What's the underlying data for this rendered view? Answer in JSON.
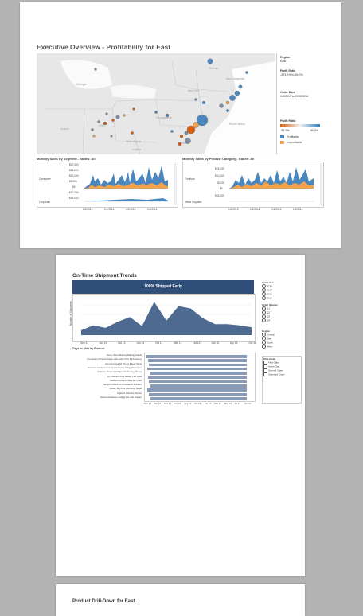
{
  "page1": {
    "title": "Executive Overview - Profitability for East",
    "region_label": "Region",
    "region_value": "East",
    "profit_ratio_label": "Profit Ratio",
    "profit_ratio_value": "-273.0% to 50.0%",
    "order_date_label": "Order Date",
    "order_date_value": "1/4/2013 to 2/15/2016",
    "profit_ratio_legend_label": "Profit Ratio",
    "ramp_min": "-93.0%",
    "ramp_max": "50.0%",
    "profitable_label": "Profitable",
    "unprofitable_label": "Unprofitable",
    "map_place_labels": [
      "Vermont",
      "New Hampshire",
      "Michigan",
      "New York",
      "Pennsylvania",
      "Rhode Island",
      "Indiana",
      "Ohio",
      "West Virginia",
      "Virginia",
      "Maryland"
    ],
    "segment_chart": {
      "title": "Monthly Sales by Segment - States: All",
      "rows": [
        "Consumer",
        "Corporate"
      ],
      "ticks": [
        "$20,000",
        "$15,000",
        "$10,000",
        "$5,000",
        "$0"
      ],
      "ticks2": [
        "$20,000",
        "$15,000"
      ],
      "xticks": [
        "1/1/2013",
        "1/1/2014",
        "1/1/2015",
        "1/1/2016"
      ]
    },
    "category_chart": {
      "title": "Monthly Sales by Product Category - States: All",
      "rows": [
        "Furniture",
        "Office Supplies"
      ],
      "ticks": [
        "$15,000",
        "$10,000",
        "$5,000",
        "$0"
      ],
      "ticks2": [
        "$15,000"
      ],
      "xticks": [
        "1/1/2013",
        "1/1/2014",
        "1/1/2015",
        "1/1/2016"
      ]
    }
  },
  "page2": {
    "title": "On-Time Shipment Trends",
    "banner": "100% Shipped Early",
    "y_axis_label": "Number of Shipments",
    "x_ticks": [
      "Sep 12",
      "Jan 13",
      "Oct 13",
      "Jan 14",
      "Oct 14",
      "Mar 15",
      "Oct 15",
      "Jan 16",
      "Apr 16",
      "Oct 16"
    ],
    "days_title": "Days to Ship by Product",
    "products": [
      "Avery Self-Adhesive Mailing Labels",
      "Companion Product Paper with Letter-Trim Perforations",
      "Acme Coated 18 Printer Paper Stock",
      "Fellowes Advanced Computer Series Surge Protectors",
      "Fellowes Stack and Tape File Storage Boxes",
      "3M Cleaning Pad Mouse Pad Pack",
      "Hewlett Packard LaserJet Toner",
      "Sanford Ultra-Fine Permanent Markers",
      "Master Big Foot Doorstop, Beige",
      "Logitech Wireless Mouse",
      "Deluxe Rollaway Locking File with Drawer"
    ],
    "day_ticks": [
      "Nov 12",
      "Jan 13",
      "Mar 13",
      "Jun 13",
      "Aug 13",
      "Oct 13",
      "Jan 14",
      "Mar 14",
      "May 14",
      "Jul 14",
      "Oct 14"
    ],
    "filters": {
      "order_year_label": "Order Year",
      "order_years": [
        "2013",
        "2014",
        "2015",
        "2016"
      ],
      "order_quarter_label": "Order Quarter",
      "quarters": [
        "Q1",
        "Q2",
        "Q3",
        "Q4"
      ],
      "region_label": "Region",
      "regions": [
        "Central",
        "East",
        "South",
        "West"
      ],
      "ship_mode_label": "Ship Mode",
      "ship_modes": [
        "First Class",
        "Same Day",
        "Second Class",
        "Standard Class"
      ]
    },
    "chart_data": {
      "type": "area",
      "title": "100% Shipped Early",
      "ylabel": "Number of Shipments",
      "x": [
        "Sep 12",
        "Jan 13",
        "Oct 13",
        "Jan 14",
        "Oct 14",
        "Mar 15",
        "Oct 15",
        "Jan 16",
        "Apr 16",
        "Oct 16"
      ],
      "values": [
        8,
        16,
        12,
        22,
        30,
        15,
        55,
        24,
        48,
        44,
        28,
        18,
        18,
        16,
        13
      ]
    }
  },
  "page3": {
    "title": "Product Drill-Down for East"
  },
  "colors": {
    "profit_blue": "#4a87bf",
    "loss_orange": "#f0a34a",
    "navy": "#2f4f7a",
    "area": "#4e6a91"
  }
}
